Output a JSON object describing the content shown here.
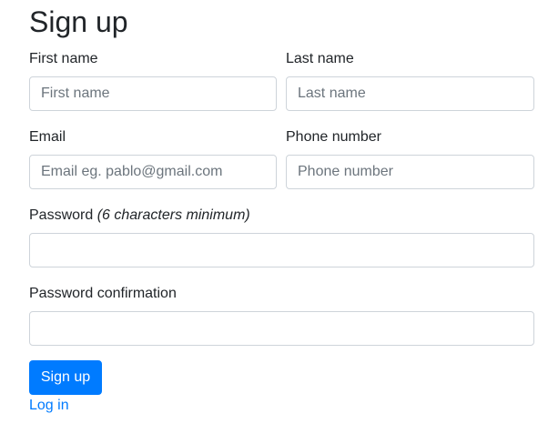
{
  "page": {
    "title": "Sign up"
  },
  "form": {
    "first_name": {
      "label": "First name",
      "placeholder": "First name",
      "value": ""
    },
    "last_name": {
      "label": "Last name",
      "placeholder": "Last name",
      "value": ""
    },
    "email": {
      "label": "Email",
      "placeholder": "Email eg. pablo@gmail.com",
      "value": ""
    },
    "phone": {
      "label": "Phone number",
      "placeholder": "Phone number",
      "value": ""
    },
    "password": {
      "label": "Password",
      "hint": "(6 characters minimum)",
      "value": ""
    },
    "password_confirmation": {
      "label": "Password confirmation",
      "value": ""
    },
    "submit_label": "Sign up",
    "login_link_label": "Log in"
  },
  "colors": {
    "primary": "#007bff",
    "text": "#212529",
    "input_border": "#ced4da",
    "placeholder": "#6c757d"
  }
}
